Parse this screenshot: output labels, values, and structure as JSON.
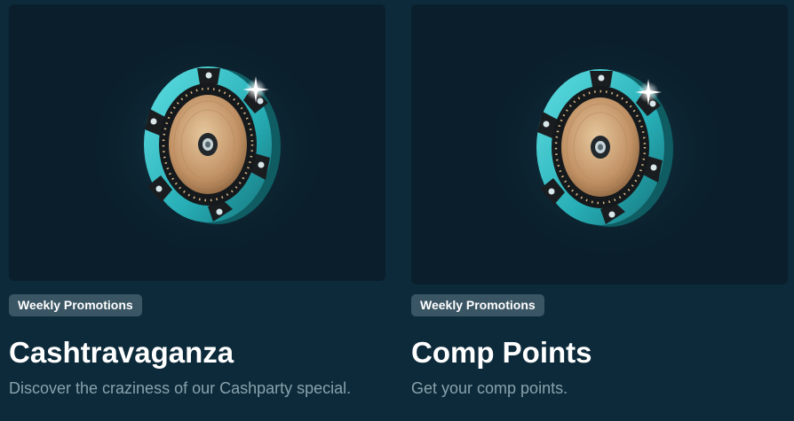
{
  "promotions": [
    {
      "tag": "Weekly Promotions",
      "title": "Cashtravaganza",
      "description": "Discover the craziness of our Cashparty special.",
      "image_icon": "poker-chip-icon"
    },
    {
      "tag": "Weekly Promotions",
      "title": "Comp Points",
      "description": "Get your comp points.",
      "image_icon": "poker-chip-icon"
    }
  ],
  "colors": {
    "page_background": "#0c2a3a",
    "card_image_background": "#0a1f2b",
    "badge_background": "#3a5563",
    "chip_teal": "#2fb8c0",
    "chip_gold": "#c9a272",
    "description_text": "#8aa1ac"
  }
}
